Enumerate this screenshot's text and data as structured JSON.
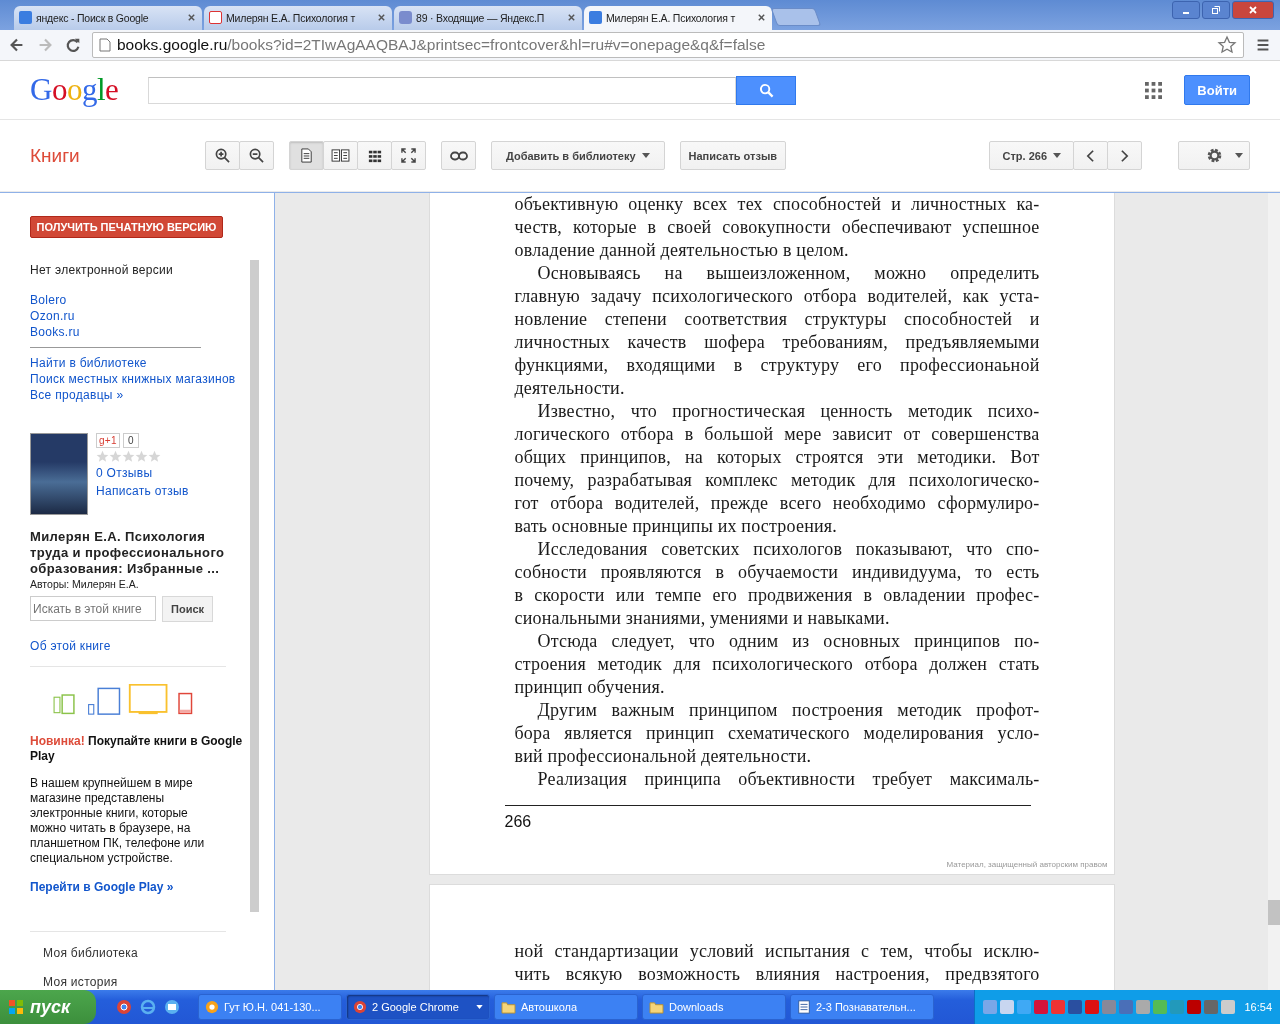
{
  "browser": {
    "tabs": [
      {
        "title": "яндекс - Поиск в Google",
        "selected": false
      },
      {
        "title": "Милерян Е.А. Психология т",
        "selected": false
      },
      {
        "title": "89 · Входящие — Яндекс.П",
        "selected": false
      },
      {
        "title": "Милерян Е.А. Психология т",
        "selected": true
      }
    ],
    "url": {
      "host": "books.google.ru",
      "path": "/books?id=2TIwAgAAQBAJ&printsec=frontcover&hl=ru#v=onepage&q&f=false"
    }
  },
  "header": {
    "logo": "Google",
    "sign_in": "Войти"
  },
  "toolbar": {
    "section": "Книги",
    "view_modes": [
      {
        "kind": "single",
        "selected": true
      },
      {
        "kind": "double",
        "selected": false
      },
      {
        "kind": "grid",
        "selected": false
      },
      {
        "kind": "fullscreen",
        "selected": false
      }
    ],
    "add_to_library": "Добавить в библиотеку",
    "write_review": "Написать отзыв",
    "page": "Стр. 266"
  },
  "sidebar": {
    "print_button": "ПОЛУЧИТЬ ПЕЧАТНУЮ ВЕРСИЮ",
    "no_ebook": "Нет электронной версии",
    "sellers": [
      "Bolero",
      "Ozon.ru",
      "Books.ru"
    ],
    "links": [
      "Найти в библиотеке",
      "Поиск местных книжных магазинов",
      "Все продавцы »"
    ],
    "book": {
      "plus_one": "g+1",
      "plus_count": "0",
      "stars": 0,
      "reviews": "0 Отзывы",
      "write_review": "Написать отзыв",
      "title": "Милерян Е.А. Психология труда и профессионального образования: Избранные ...",
      "authors": "Авторы: Милерян Е.А."
    },
    "search": {
      "placeholder": "Искать в этой книге",
      "button": "Поиск"
    },
    "about": "Об этой книге",
    "promo": {
      "badge": "Новинка!",
      "headline": "Покупайте книги в Google Play",
      "body": "В нашем крупнейшем в мире магазине представлены электронные книги, которые можно читать в браузере, на планшетном ПК, телефоне или специальном устройстве.",
      "link": "Перейти в Google Play »"
    },
    "menu": [
      "Моя библиотека",
      "Моя история"
    ]
  },
  "pages": [
    {
      "paragraphs": [
        {
          "indent": false,
          "continues": false,
          "lines": [
            "объективную оценку всех тех способностей и личностных ка-",
            "честв, которые в своей совокупности обеспечивают успешное",
            "овладение данной деятельностью в целом."
          ]
        },
        {
          "indent": true,
          "continues": false,
          "lines": [
            "Основываясь на вышеизложенном, можно определить",
            "главную задачу психологического отбора водителей, как уста-",
            "новление степени соответствия структуры способностей и",
            "личностных качеств шофера требованиям, предъявляемыми",
            "функциями, входящими в структуру его профессионаьной",
            "деятельности."
          ]
        },
        {
          "indent": true,
          "continues": false,
          "lines": [
            "Известно, что прогностическая ценность методик психо-",
            "логического отбора в большой мере зависит от совершенства",
            "общих принципов, на которых строятся эти методики. Вот",
            "почему, разрабатывая комплекс методик для психологическо-",
            "гот отбора водителей, прежде всего необходимо сформулиро-",
            "вать основные принципы их построения."
          ]
        },
        {
          "indent": true,
          "continues": false,
          "lines": [
            "Исследования советских психологов показывают, что спо-",
            "собности проявляются в обучаемости индивидуума, то есть",
            "в скорости или темпе его продвижения в овладении профес-",
            "сиональными знаниями, умениями и навыками."
          ]
        },
        {
          "indent": true,
          "continues": false,
          "lines": [
            "Отсюда следует, что одним из основных принципов по-",
            "строения методик для психологического отбора должен стать",
            "принцип обучения."
          ]
        },
        {
          "indent": true,
          "continues": false,
          "lines": [
            "Другим важным принципом построения методик профот-",
            "бора является принцип схематического моделирования усло-",
            "вий профессиональной деятельности."
          ]
        },
        {
          "indent": true,
          "continues": true,
          "lines": [
            "Реализация принципа объективности требует максималь-"
          ]
        }
      ],
      "page_number": "266",
      "copyright": "Материал, защищенный авторским правом"
    },
    {
      "paragraphs": [
        {
          "indent": false,
          "continues": true,
          "lines": [
            "ной стандартизации условий испытания с тем, чтобы исклю-",
            "чить всякую возможность влияния настроения, предвзятого"
          ]
        }
      ]
    }
  ],
  "taskbar": {
    "start": "пуск",
    "tasks": [
      {
        "label": "Гут Ю.Н. 041-130...",
        "selected": false
      },
      {
        "label": "2 Google Chrome",
        "selected": true
      },
      {
        "label": "Автошкола",
        "selected": false
      },
      {
        "label": "Downloads",
        "selected": false
      },
      {
        "label": "2-3 Познавательн...",
        "selected": false
      }
    ],
    "clock": "16:54"
  }
}
